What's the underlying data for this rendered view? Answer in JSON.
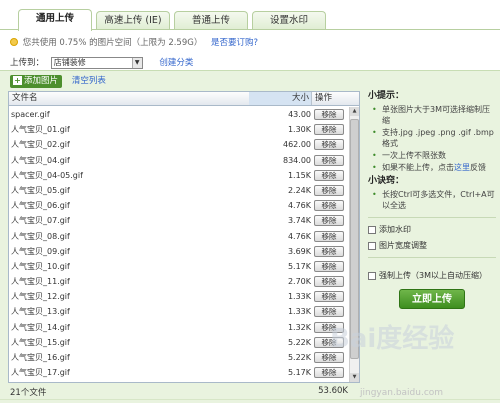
{
  "tabs": [
    {
      "label": "通用上传",
      "active": true
    },
    {
      "label": "高速上传 (IE)",
      "active": false
    },
    {
      "label": "普通上传",
      "active": false
    },
    {
      "label": "设置水印",
      "active": false
    }
  ],
  "info": {
    "usage": "您共使用 0.75% 的图片空间（上限为 2.59G）",
    "link": "是否要订购?"
  },
  "upload_to": {
    "label": "上传到：",
    "selected": "店铺装修",
    "create_link": "创建分类"
  },
  "toolbar": {
    "add_label": "添加图片",
    "clear_label": "清空列表"
  },
  "file_table": {
    "headers": {
      "name": "文件名",
      "size": "大小",
      "action": "操作"
    },
    "remove_label": "移除",
    "rows": [
      {
        "name": "spacer.gif",
        "size": "43.00"
      },
      {
        "name": "人气宝贝_01.gif",
        "size": "1.30K"
      },
      {
        "name": "人气宝贝_02.gif",
        "size": "462.00"
      },
      {
        "name": "人气宝贝_04.gif",
        "size": "834.00"
      },
      {
        "name": "人气宝贝_04-05.gif",
        "size": "1.15K"
      },
      {
        "name": "人气宝贝_05.gif",
        "size": "2.24K"
      },
      {
        "name": "人气宝贝_06.gif",
        "size": "4.76K"
      },
      {
        "name": "人气宝贝_07.gif",
        "size": "3.74K"
      },
      {
        "name": "人气宝贝_08.gif",
        "size": "4.76K"
      },
      {
        "name": "人气宝贝_09.gif",
        "size": "3.69K"
      },
      {
        "name": "人气宝贝_10.gif",
        "size": "5.17K"
      },
      {
        "name": "人气宝贝_11.gif",
        "size": "2.70K"
      },
      {
        "name": "人气宝贝_12.gif",
        "size": "1.33K"
      },
      {
        "name": "人气宝贝_13.gif",
        "size": "1.33K"
      },
      {
        "name": "人气宝贝_14.gif",
        "size": "1.32K"
      },
      {
        "name": "人气宝贝_15.gif",
        "size": "5.22K"
      },
      {
        "name": "人气宝贝_16.gif",
        "size": "5.22K"
      },
      {
        "name": "人气宝贝_17.gif",
        "size": "5.17K"
      }
    ],
    "footer": {
      "count": "21个文件",
      "total": "53.60K"
    }
  },
  "side": {
    "tips_title": "小提示：",
    "tips": [
      "单张图片大于3M可选择缩制压缩",
      "支持.jpg .jpeg .png .gif .bmp格式",
      "一次上传不限张数"
    ],
    "tip_last_pre": "如果不能上传，点击",
    "tip_last_link": "这里",
    "tip_last_post": "反馈",
    "tricks_title": "小诀窍：",
    "tricks": [
      "长按Ctrl可多选文件，Ctrl+A可以全选"
    ],
    "options": {
      "watermark": "添加水印",
      "resize": "图片宽度调整",
      "force": "强制上传（3M以上自动压缩）"
    },
    "upload_button": "立即上传"
  },
  "watermark_text": "Bai度经验",
  "watermark_url": "jingyan.baidu.com"
}
